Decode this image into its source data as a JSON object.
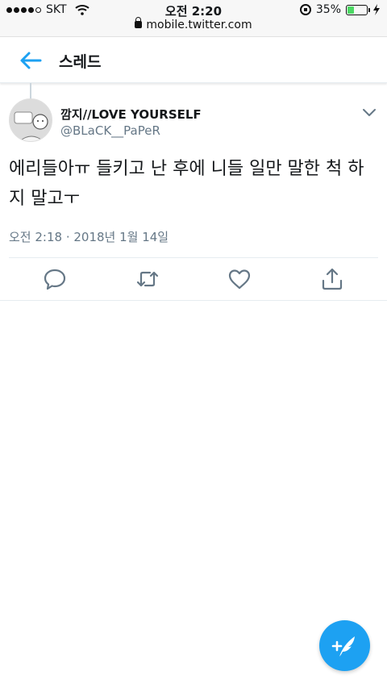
{
  "status_bar": {
    "carrier": "SKT",
    "time": "오전 2:20",
    "url": "mobile.twitter.com",
    "battery_percent": "35%",
    "battery_level": 0.35
  },
  "header": {
    "title": "스레드",
    "back_icon": "arrow-left-icon"
  },
  "tweet": {
    "user_name": "깜지//LOVE YOURSELF",
    "user_handle": "@BLaCK__PaPeR",
    "text": "에리들아ㅠ 들키고 난 후에 니들 일만 말한 척 하지 말고ㅜ",
    "timestamp": "오전 2:18 · 2018년 1월 14일"
  },
  "actions": [
    "reply-icon",
    "retweet-icon",
    "like-icon",
    "share-icon"
  ],
  "compose": {
    "icon": "compose-feather-icon"
  },
  "colors": {
    "accent": "#1da1f2",
    "secondary_text": "#657786",
    "divider": "#e6ecf0"
  }
}
